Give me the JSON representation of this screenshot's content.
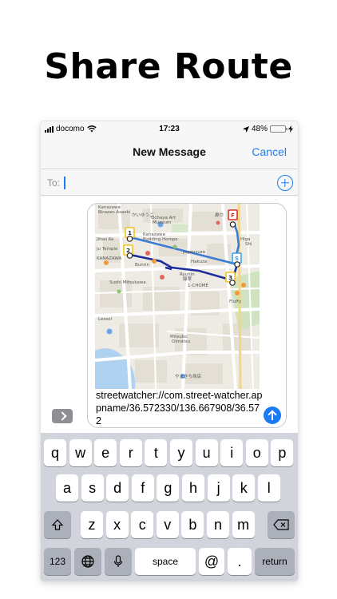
{
  "headline": "Share Route",
  "status_bar": {
    "carrier": "docomo",
    "time": "17:23",
    "battery": "48%",
    "battery_level": 0.48
  },
  "nav": {
    "title": "New Message",
    "cancel": "Cancel"
  },
  "to_field": {
    "label": "To:"
  },
  "message": {
    "text": "streetwatcher://com.street-watcher.appname/36.572330/136.667908/36.572",
    "map_labels": {
      "kanazawa_shokudo": "Kanazawa\nBirazan Asaoki",
      "kaiyugo": "かいゆうご",
      "ochaya": "Ochaya Art\nMuseum",
      "mayor": "鼻ロ",
      "higashi": "Higa",
      "shi": "Shi",
      "kanazawa_yasuragi": "Kanazawa\nPudding Hompo",
      "jitsuen": "Jitsei Ke",
      "juganoji": "Jugansuzo",
      "jiko_temple": "ju Temple",
      "kanazawa_fu": "KANAZAWA\nFU",
      "hakuzan": "Hakuza",
      "ryuhin": "Ryuhin",
      "bunriza": "Bunrin",
      "ryoku": "緑翠",
      "sushi": "Sushi Mitsukawa",
      "chome": "1-CHOME",
      "fluffy": "Fluffy",
      "lessoi": "Lessol",
      "mitsuko": "Mitsuko\nOimatsu",
      "yamamoto": "やまきち商店",
      "higashi_chaya": "Higashi\nChaya"
    },
    "markers": [
      "F",
      "1",
      "2",
      "3",
      "S"
    ]
  },
  "keyboard": {
    "row1": [
      "q",
      "w",
      "e",
      "r",
      "t",
      "y",
      "u",
      "i",
      "o",
      "p"
    ],
    "row2": [
      "a",
      "s",
      "d",
      "f",
      "g",
      "h",
      "j",
      "k",
      "l"
    ],
    "row3": [
      "z",
      "x",
      "c",
      "v",
      "b",
      "n",
      "m"
    ],
    "num_key": "123",
    "space": "space",
    "at": "@",
    "period": ".",
    "return": "return"
  },
  "colors": {
    "accent": "#1a7cf5",
    "route_dark": "#1d2d9c",
    "route_light": "#3a7bd5",
    "marker_yellow": "#f2c419",
    "marker_red": "#d9302c",
    "marker_blue": "#3aa0e8"
  }
}
